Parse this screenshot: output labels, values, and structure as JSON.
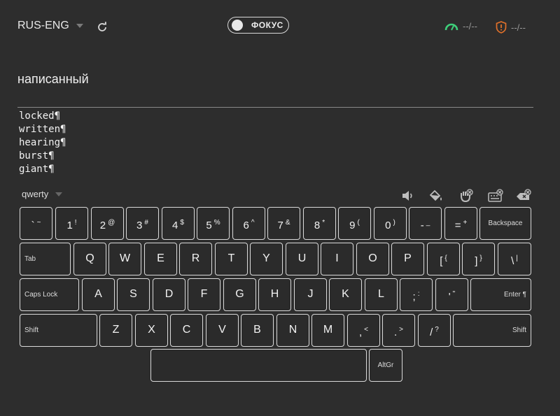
{
  "header": {
    "language": "RUS-ENG",
    "focus_label": "ФОКУС",
    "speed": "--/--",
    "errors": "--/--"
  },
  "current_word": "написанный",
  "word_list": [
    "locked¶",
    "written¶",
    "hearing¶",
    "burst¶",
    "giant¶"
  ],
  "layout_name": "qwerty",
  "icons": {
    "toolbar": [
      "speaker-icon",
      "paint-bucket-icon",
      "hand-off-icon",
      "keyboard-off-icon",
      "backspace-off-icon"
    ]
  },
  "colors": {
    "background": "#2d2d2d",
    "speed_icon": "#3ecf7a",
    "error_icon": "#e0702a"
  },
  "keyboard": {
    "row1": [
      {
        "a": "`",
        "b": "~"
      },
      {
        "a": "1",
        "b": "!"
      },
      {
        "a": "2",
        "b": "@"
      },
      {
        "a": "3",
        "b": "#"
      },
      {
        "a": "4",
        "b": "$"
      },
      {
        "a": "5",
        "b": "%"
      },
      {
        "a": "6",
        "b": "^"
      },
      {
        "a": "7",
        "b": "&"
      },
      {
        "a": "8",
        "b": "*"
      },
      {
        "a": "9",
        "b": "("
      },
      {
        "a": "0",
        "b": ")"
      },
      {
        "a": "-",
        "b": "_"
      },
      {
        "a": "=",
        "b": "+"
      }
    ],
    "backspace": "Backspace",
    "tab": "Tab",
    "row2": [
      "Q",
      "W",
      "E",
      "R",
      "T",
      "Y",
      "U",
      "I",
      "O",
      "P"
    ],
    "row2_punct": [
      {
        "a": "[",
        "b": "{"
      },
      {
        "a": "]",
        "b": "}"
      },
      {
        "a": "\\",
        "b": "|"
      }
    ],
    "caps_lock": "Caps Lock",
    "row3": [
      "A",
      "S",
      "D",
      "F",
      "G",
      "H",
      "J",
      "K",
      "L"
    ],
    "row3_punct": [
      {
        "a": ";",
        "b": ":"
      },
      {
        "a": "'",
        "b": "\""
      }
    ],
    "enter": "Enter ¶",
    "shift_left": "Shift",
    "row4": [
      "Z",
      "X",
      "C",
      "V",
      "B",
      "N",
      "M"
    ],
    "row4_punct": [
      {
        "a": ",",
        "b": "<"
      },
      {
        "a": ".",
        "b": ">"
      },
      {
        "a": "/",
        "b": "?"
      }
    ],
    "shift_right": "Shift",
    "altgr": "AltGr"
  }
}
